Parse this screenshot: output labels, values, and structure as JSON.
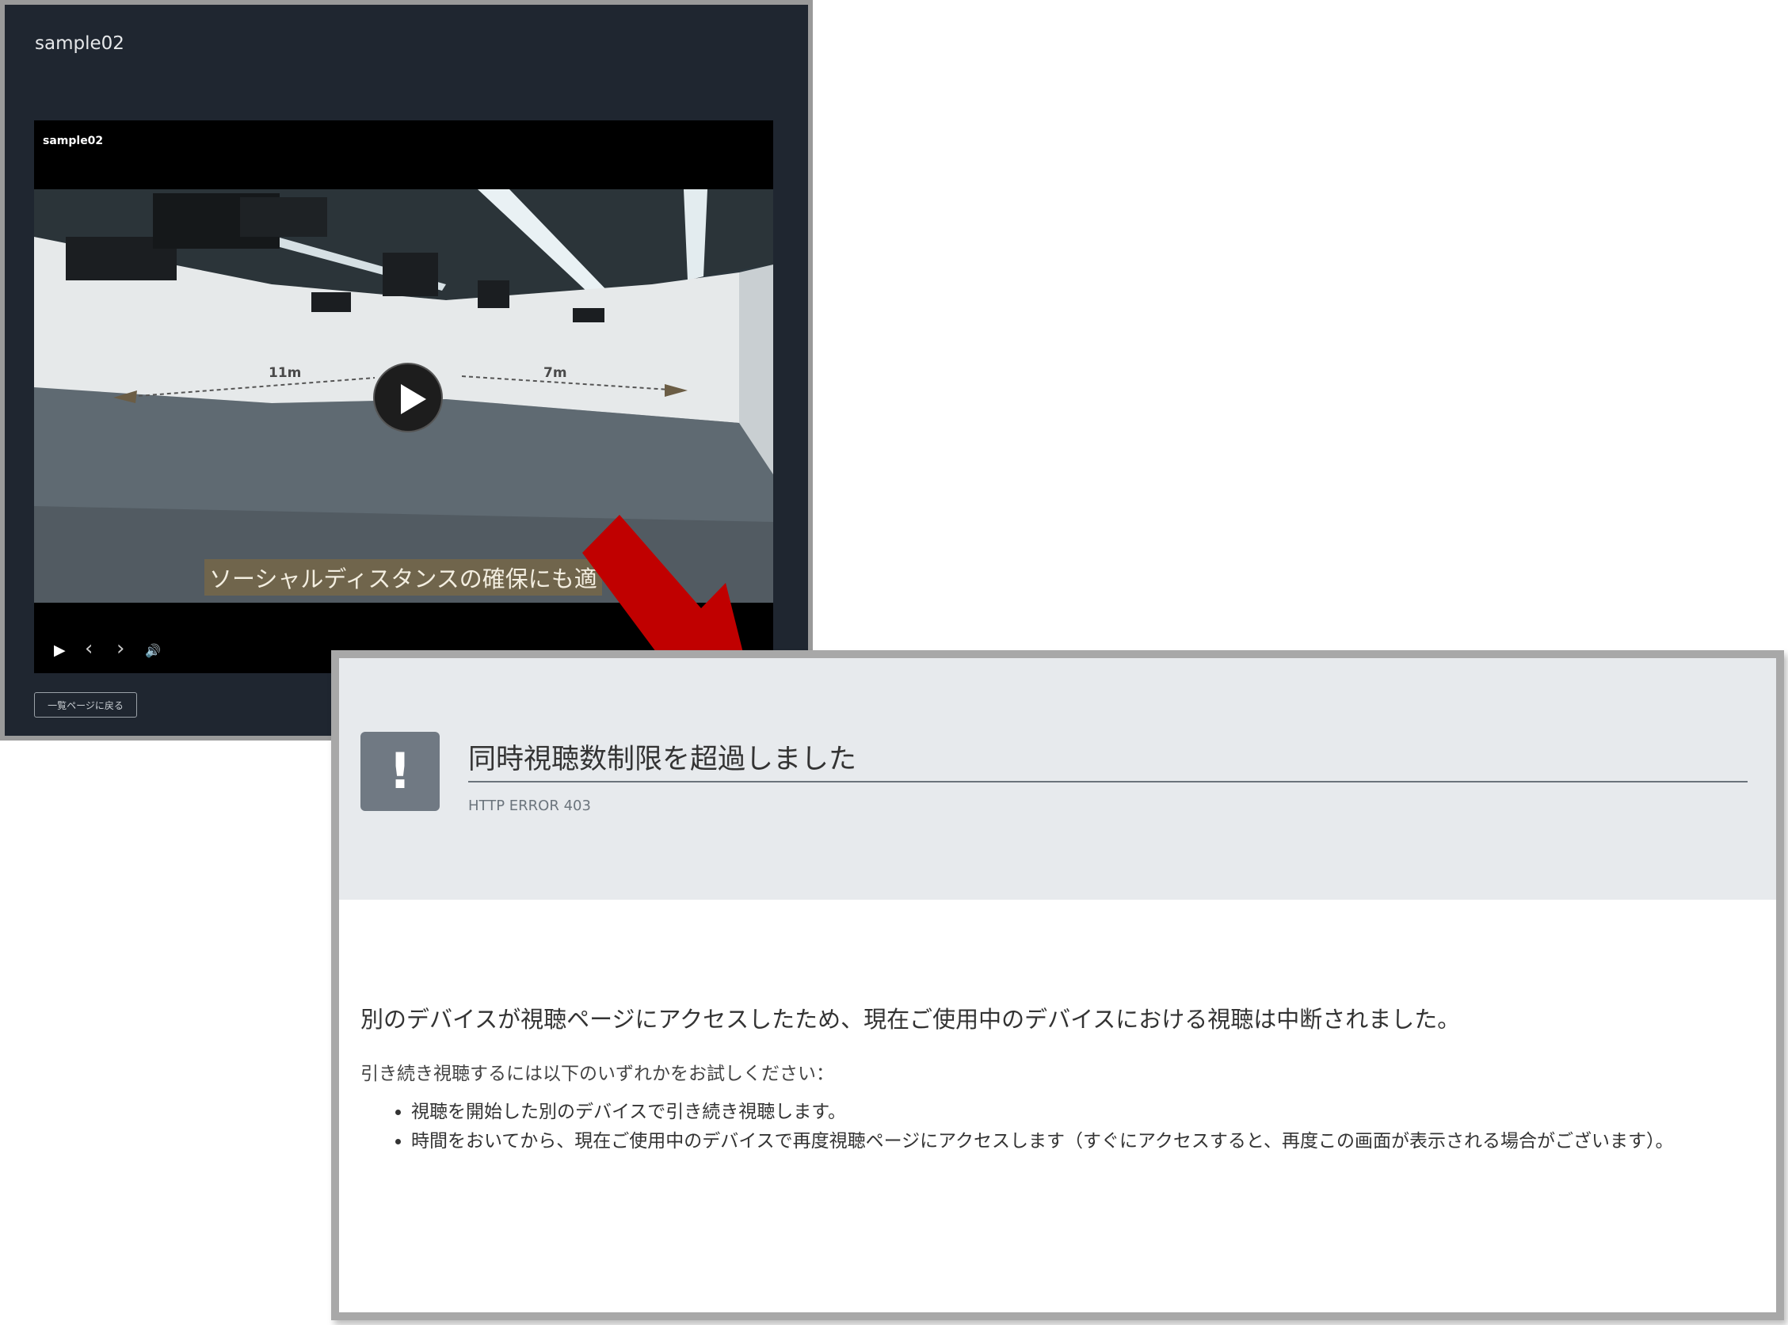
{
  "player": {
    "page_title": "sample02",
    "video_title": "sample02",
    "subtitle": "ソーシャルディスタンスの確保にも適",
    "dim_left": "11m",
    "dim_right": "7m",
    "controls": {
      "play": "▶",
      "prev": "‹",
      "next": "›",
      "volume": "🔊"
    },
    "back_button": "一覧ページに戻る"
  },
  "error": {
    "icon": "!",
    "title": "同時視聴数制限を超過しました",
    "code": "HTTP ERROR 403",
    "message": "別のデバイスが視聴ページにアクセスしたため、現在ご使用中のデバイスにおける視聴は中断されました。",
    "instruction": "引き続き視聴するには以下のいずれかをお試しください：",
    "options": [
      "視聴を開始した別のデバイスで引き続き視聴します。",
      "時間をおいてから、現在ご使用中のデバイスで再度視聴ページにアクセスします（すぐにアクセスすると、再度この画面が表示される場合がございます）。"
    ]
  },
  "colors": {
    "arrow": "#c00000",
    "player_bg": "#1f2630",
    "error_header_bg": "#e7eaed"
  }
}
